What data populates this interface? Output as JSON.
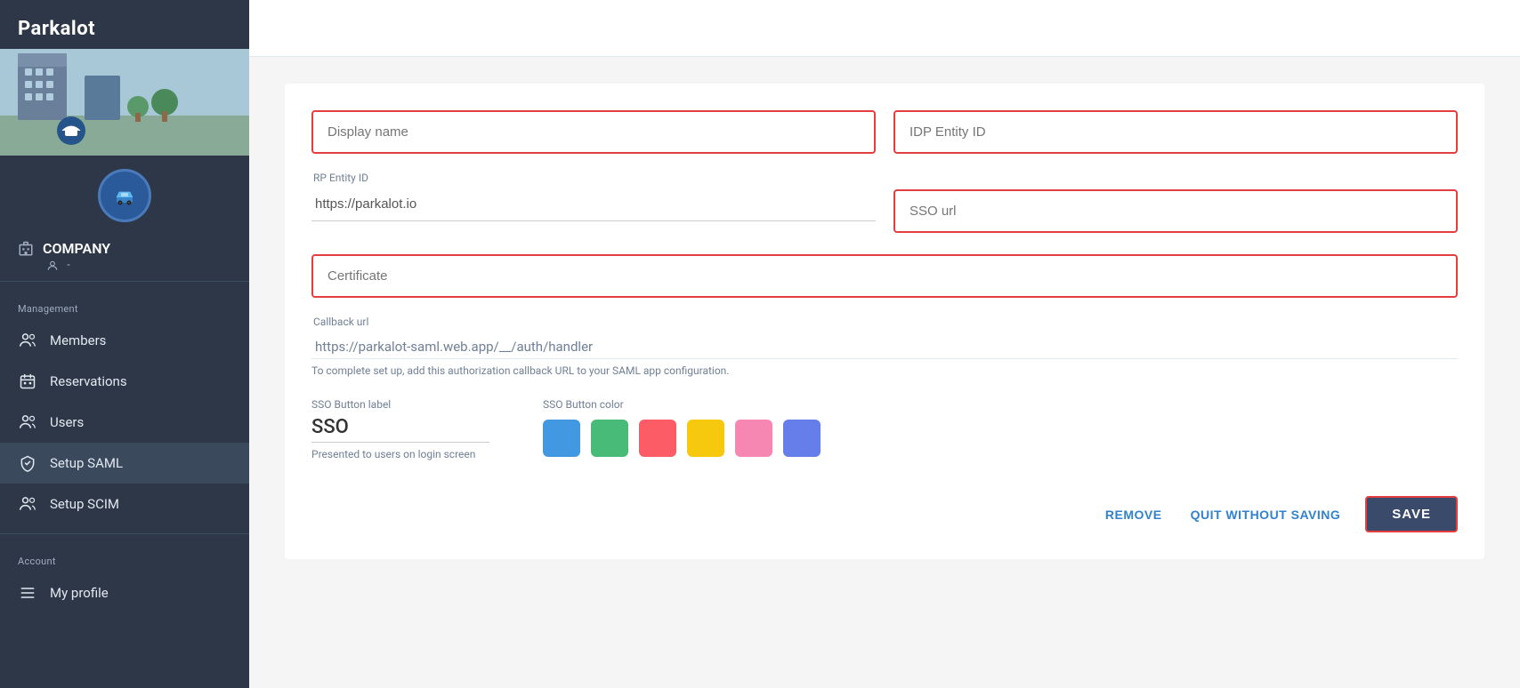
{
  "app": {
    "title": "Parkalot"
  },
  "sidebar": {
    "company_label": "COMPANY",
    "company_sub": "-",
    "management_label": "Management",
    "account_label": "Account",
    "nav_items": [
      {
        "id": "members",
        "label": "Members",
        "icon": "people-icon"
      },
      {
        "id": "reservations",
        "label": "Reservations",
        "icon": "calendar-icon"
      },
      {
        "id": "users",
        "label": "Users",
        "icon": "people-icon"
      },
      {
        "id": "setup-saml",
        "label": "Setup SAML",
        "icon": "shield-icon"
      },
      {
        "id": "setup-scim",
        "label": "Setup SCIM",
        "icon": "people-icon"
      }
    ],
    "account_items": [
      {
        "id": "my-profile",
        "label": "My profile",
        "icon": "menu-icon"
      }
    ]
  },
  "form": {
    "display_name_placeholder": "Display name",
    "idp_entity_id_placeholder": "IDP Entity ID",
    "rp_entity_id_label": "RP Entity ID",
    "rp_entity_id_value": "https://parkalot.io",
    "sso_url_placeholder": "SSO url",
    "certificate_placeholder": "Certificate",
    "callback_url_label": "Callback url",
    "callback_url_value": "https://parkalot-saml.web.app/__/auth/handler",
    "callback_url_hint": "To complete set up, add this authorization callback URL to your SAML app configuration.",
    "sso_button_label": "SSO Button label",
    "sso_button_value": "SSO",
    "sso_button_hint": "Presented to users on login screen",
    "sso_button_color_label": "SSO Button color",
    "colors": [
      {
        "name": "blue",
        "hex": "#4299e1"
      },
      {
        "name": "green",
        "hex": "#48bb78"
      },
      {
        "name": "red",
        "hex": "#fc5c65"
      },
      {
        "name": "yellow",
        "hex": "#f6c90e"
      },
      {
        "name": "pink",
        "hex": "#f687b3"
      },
      {
        "name": "indigo",
        "hex": "#667eea"
      }
    ]
  },
  "actions": {
    "remove_label": "REMOVE",
    "quit_label": "QUIT WITHOUT SAVING",
    "save_label": "SAVE"
  }
}
